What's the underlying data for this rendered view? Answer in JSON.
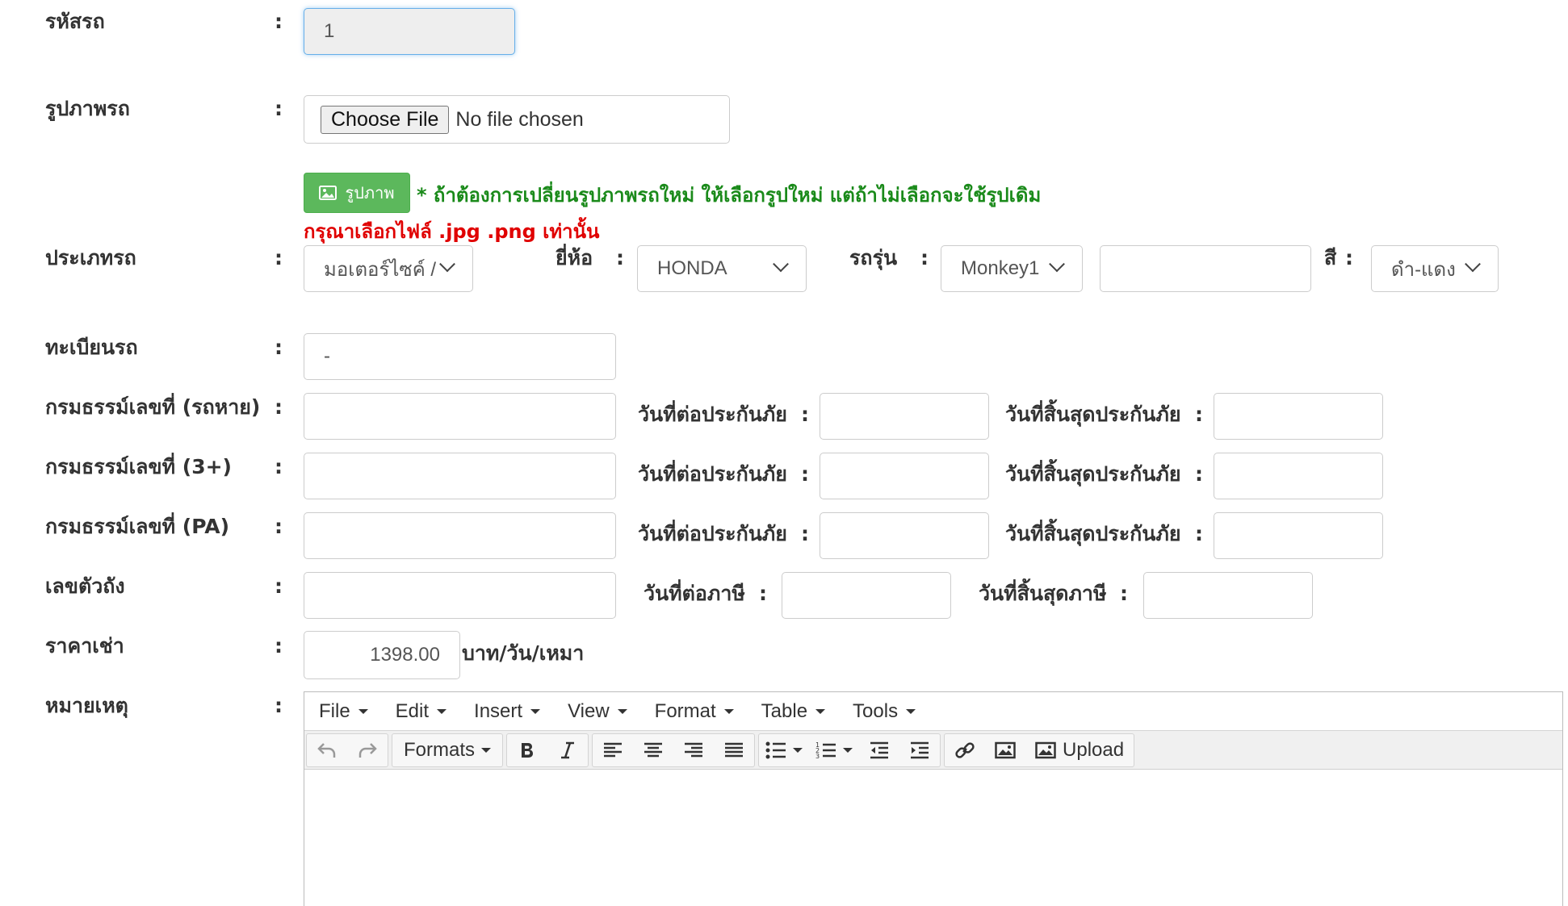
{
  "labels": {
    "car_code": "รหัสรถ",
    "car_image": "รูปภาพรถ",
    "car_type": "ประเภทรถ",
    "brand": "ยี่ห้อ",
    "model": "รถรุ่น",
    "color": "สี",
    "plate": "ทะเบียนรถ",
    "policy_lost": "กรมธรรม์เลขที่ (รถหาย)",
    "policy_3plus": "กรมธรรม์เลขที่ (3+)",
    "policy_pa": "กรมธรรม์เลขที่ (PA)",
    "chassis": "เลขตัวถัง",
    "rent_price": "ราคาเช่า",
    "remark": "หมายเหตุ",
    "colon": ":",
    "renew_insurance": "วันที่ต่อประกันภัย",
    "end_insurance": "วันที่สิ้นสุดประกันภัย",
    "renew_tax": "วันที่ต่อภาษี",
    "end_tax": "วันที่สิ้นสุดภาษี",
    "price_unit": "บาท/วัน/เหมา"
  },
  "values": {
    "car_code": "1",
    "car_type": "มอเตอร์ไซค์ /",
    "brand": "HONDA",
    "model": "Monkey1",
    "model_extra": "",
    "color": "ดำ-แดง",
    "plate": "-",
    "policy_lost": "",
    "policy_3plus": "",
    "policy_pa": "",
    "chassis": "",
    "rent_price": "1398.00",
    "renew_ins_1": "",
    "end_ins_1": "",
    "renew_ins_2": "",
    "end_ins_2": "",
    "renew_ins_3": "",
    "end_ins_3": "",
    "renew_tax": "",
    "end_tax": ""
  },
  "file_input": {
    "button": "Choose File",
    "status": "No file chosen"
  },
  "image_button": {
    "label": "รูปภาพ",
    "icon": "image-icon"
  },
  "notes": {
    "change_image": "* ถ้าต้องการเปลี่ยนรูปภาพรถใหม่ ให้เลือกรูปใหม่ แต่ถ้าไม่เลือกจะใช้รูปเดิม",
    "file_types": "กรุณาเลือกไฟล์ .jpg .png เท่านั้น"
  },
  "editor": {
    "menu": [
      "File",
      "Edit",
      "Insert",
      "View",
      "Format",
      "Table",
      "Tools"
    ],
    "formats_label": "Formats",
    "upload_label": "Upload"
  },
  "colors": {
    "green": "#5cb85c",
    "note_green": "#1a8a1a",
    "note_red": "#e00000"
  }
}
